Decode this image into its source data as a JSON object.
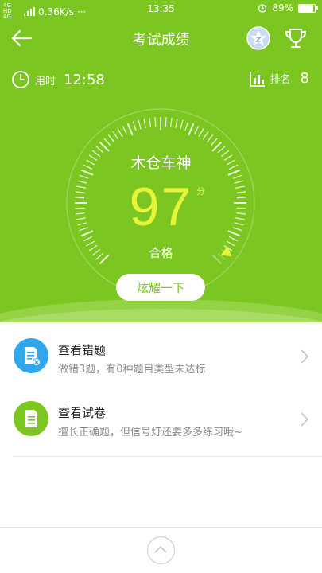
{
  "status_bar": {
    "network_top": "4G HD",
    "network_bottom": "4G",
    "speed": "0.36K/s",
    "dots": "···",
    "time": "13:35",
    "battery": "89%",
    "battery_level": 0.89
  },
  "nav": {
    "title": "考试成绩",
    "back_icon": "arrow-left-icon",
    "badge_icon": "star-badge-icon",
    "trophy_icon": "trophy-icon"
  },
  "stats": {
    "time_label": "用时",
    "time_value": "12:58",
    "rank_label": "排名",
    "rank_value": "8"
  },
  "result": {
    "user_name": "木仓车神",
    "score": "97",
    "score_unit": "分",
    "status": "合格",
    "score_fraction": 0.97
  },
  "share_button": "炫耀一下",
  "menu": [
    {
      "title": "查看错题",
      "subtitle": "做错3题，有0种题目类型未达标",
      "icon": "error-doc-icon",
      "color": "#2ea7ef"
    },
    {
      "title": "查看试卷",
      "subtitle": "擅长正确题，但信号灯还要多多练习哦~",
      "icon": "paper-doc-icon",
      "color": "#7cc621"
    }
  ],
  "colors": {
    "brand_green": "#7cc621",
    "score_yellow": "#e6f53a"
  }
}
